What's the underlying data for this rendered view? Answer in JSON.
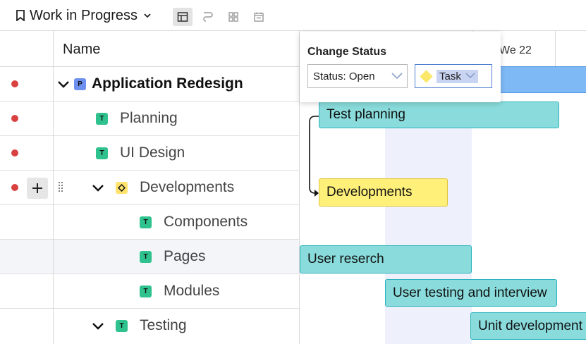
{
  "toolbar": {
    "view_title": "Work in Progress",
    "buttons": [
      "grid-view",
      "dependency",
      "board-view",
      "calendar-view"
    ]
  },
  "grid": {
    "name_header": "Name",
    "rows": [
      {
        "label": "Application Redesign",
        "type": "P",
        "bold": true,
        "expanded": true,
        "status_dot": true
      },
      {
        "label": "Planning",
        "type": "T",
        "status_dot": true
      },
      {
        "label": "UI Design",
        "type": "T",
        "status_dot": true
      },
      {
        "label": "Developments",
        "type": "milestone",
        "expanded": true,
        "status_dot": true
      },
      {
        "label": "Components",
        "type": "T"
      },
      {
        "label": "Pages",
        "type": "T"
      },
      {
        "label": "Modules",
        "type": "T"
      },
      {
        "label": "Testing",
        "type": "T",
        "expanded": true
      }
    ]
  },
  "gantt": {
    "day_label": "We 22",
    "bars": [
      {
        "label": "",
        "kind": "project"
      },
      {
        "label": "Test planning",
        "kind": "task"
      },
      {
        "label": "Developments",
        "kind": "milestone"
      },
      {
        "label": "User reserch",
        "kind": "task"
      },
      {
        "label": "User testing and interview",
        "kind": "task"
      },
      {
        "label": "Unit development",
        "kind": "task"
      }
    ]
  },
  "popup": {
    "title": "Change Status",
    "status_value": "Status: Open",
    "type_value": "Task"
  },
  "colors": {
    "status_dot": "#d94141",
    "task_badge": "#2fc28f",
    "project_badge": "#6d8ff0",
    "task_bar": "#8adcdc",
    "milestone_bar": "#fff07a",
    "project_bar": "#7eb9f6"
  }
}
